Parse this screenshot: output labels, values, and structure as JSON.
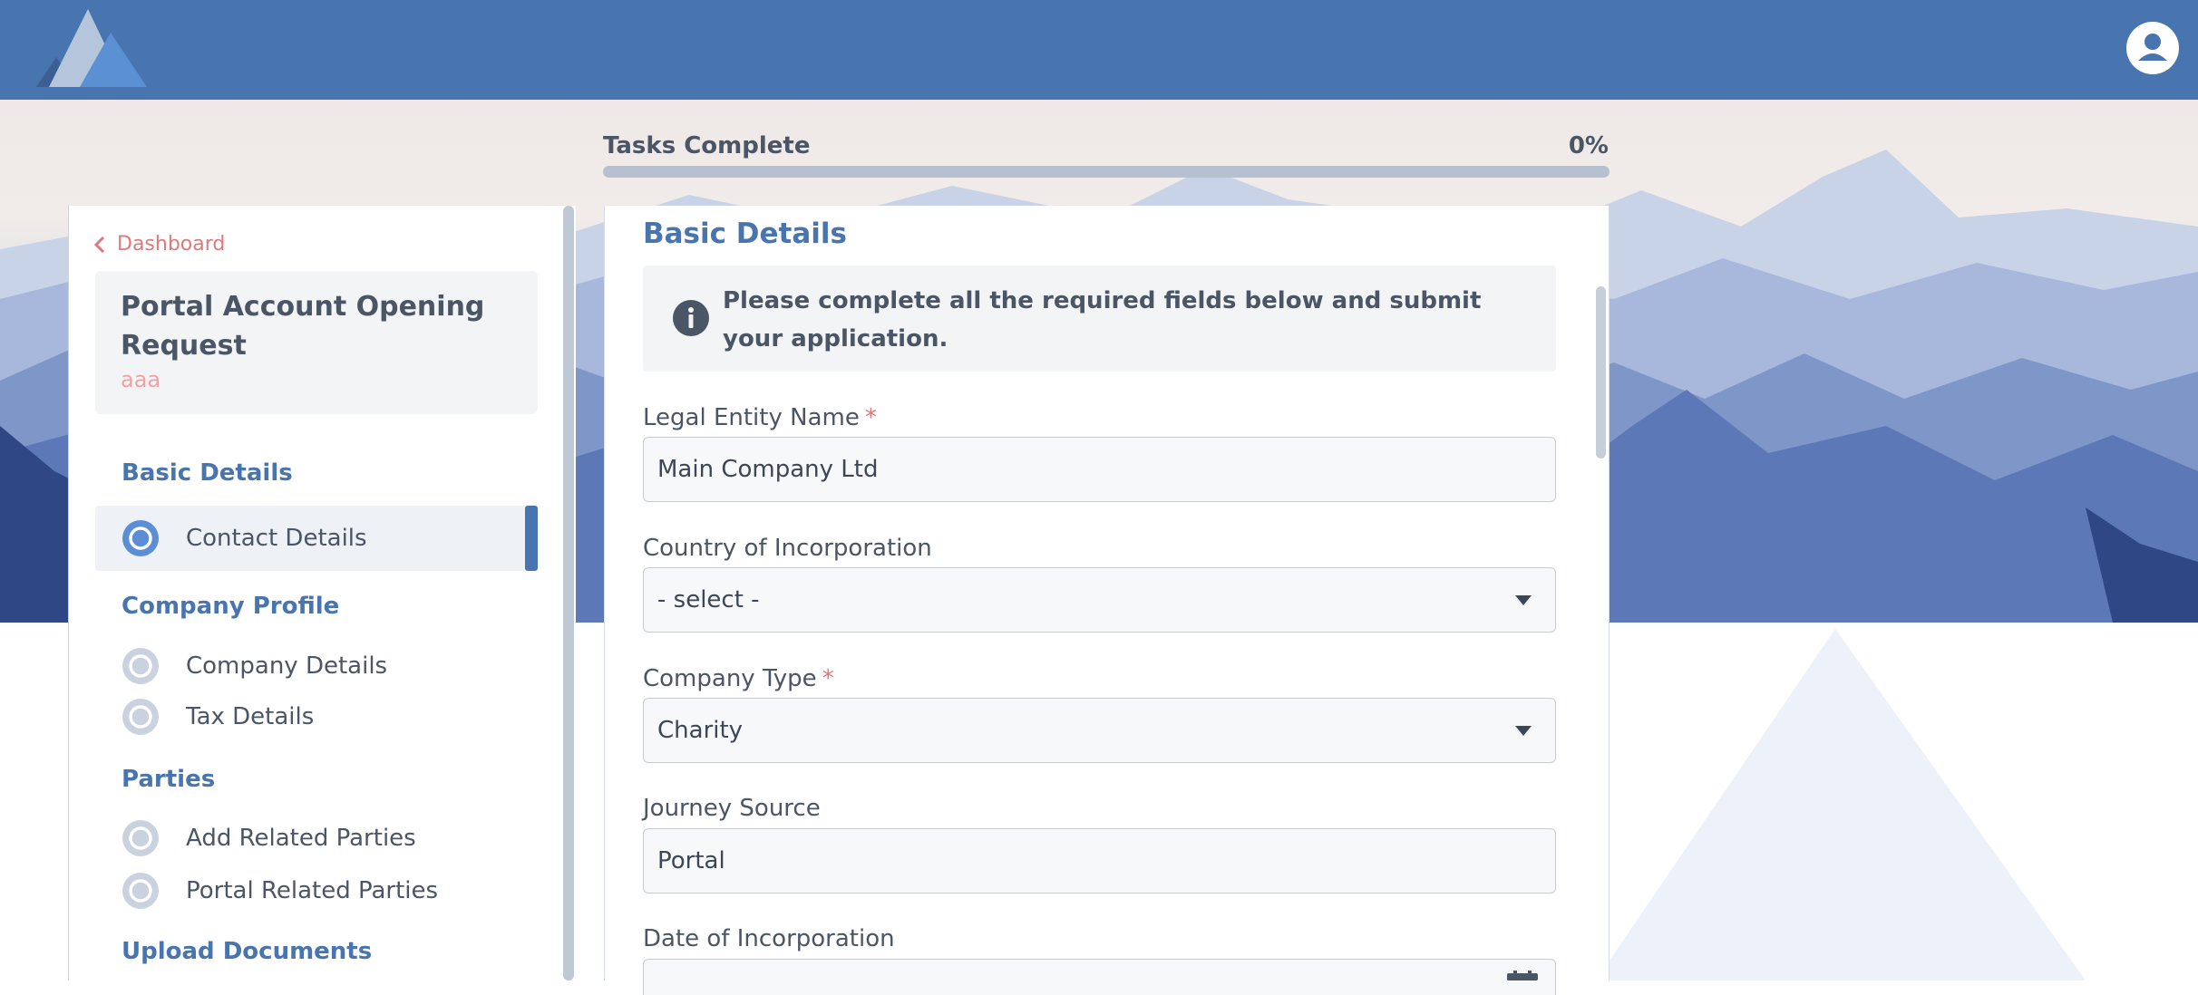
{
  "header": {
    "logo_icon": "mountain-logo-icon",
    "avatar_icon": "user-avatar-icon",
    "colors": {
      "bar": "#4874b0",
      "accent": "#4874b0",
      "danger": "#e0787a"
    }
  },
  "progress": {
    "label": "Tasks Complete",
    "percent_text": "0%",
    "value": 0
  },
  "sidebar": {
    "back_label": "Dashboard",
    "request_title": "Portal Account Opening Request",
    "request_subtitle": "aaa",
    "sections": [
      {
        "title": "Basic Details",
        "items": [
          {
            "label": "Contact Details",
            "active": true
          }
        ]
      },
      {
        "title": "Company Profile",
        "items": [
          {
            "label": "Company Details"
          },
          {
            "label": "Tax Details"
          }
        ]
      },
      {
        "title": "Parties",
        "items": [
          {
            "label": "Add Related Parties"
          },
          {
            "label": "Portal Related Parties"
          }
        ]
      },
      {
        "title": "Upload Documents",
        "items": []
      }
    ]
  },
  "main": {
    "title": "Basic Details",
    "notice": "Please complete all the required fields below and submit your application.",
    "fields": [
      {
        "label": "Legal Entity Name",
        "required": true,
        "value": "Main Company Ltd",
        "type": "text"
      },
      {
        "label": "Country of Incorporation",
        "required": false,
        "value": "- select -",
        "type": "select"
      },
      {
        "label": "Company Type",
        "required": true,
        "value": "Charity",
        "type": "select"
      },
      {
        "label": "Journey Source",
        "required": false,
        "value": "Portal",
        "type": "text"
      },
      {
        "label": "Date of Incorporation",
        "required": false,
        "value": "",
        "type": "date"
      }
    ],
    "required_marker": "*"
  }
}
